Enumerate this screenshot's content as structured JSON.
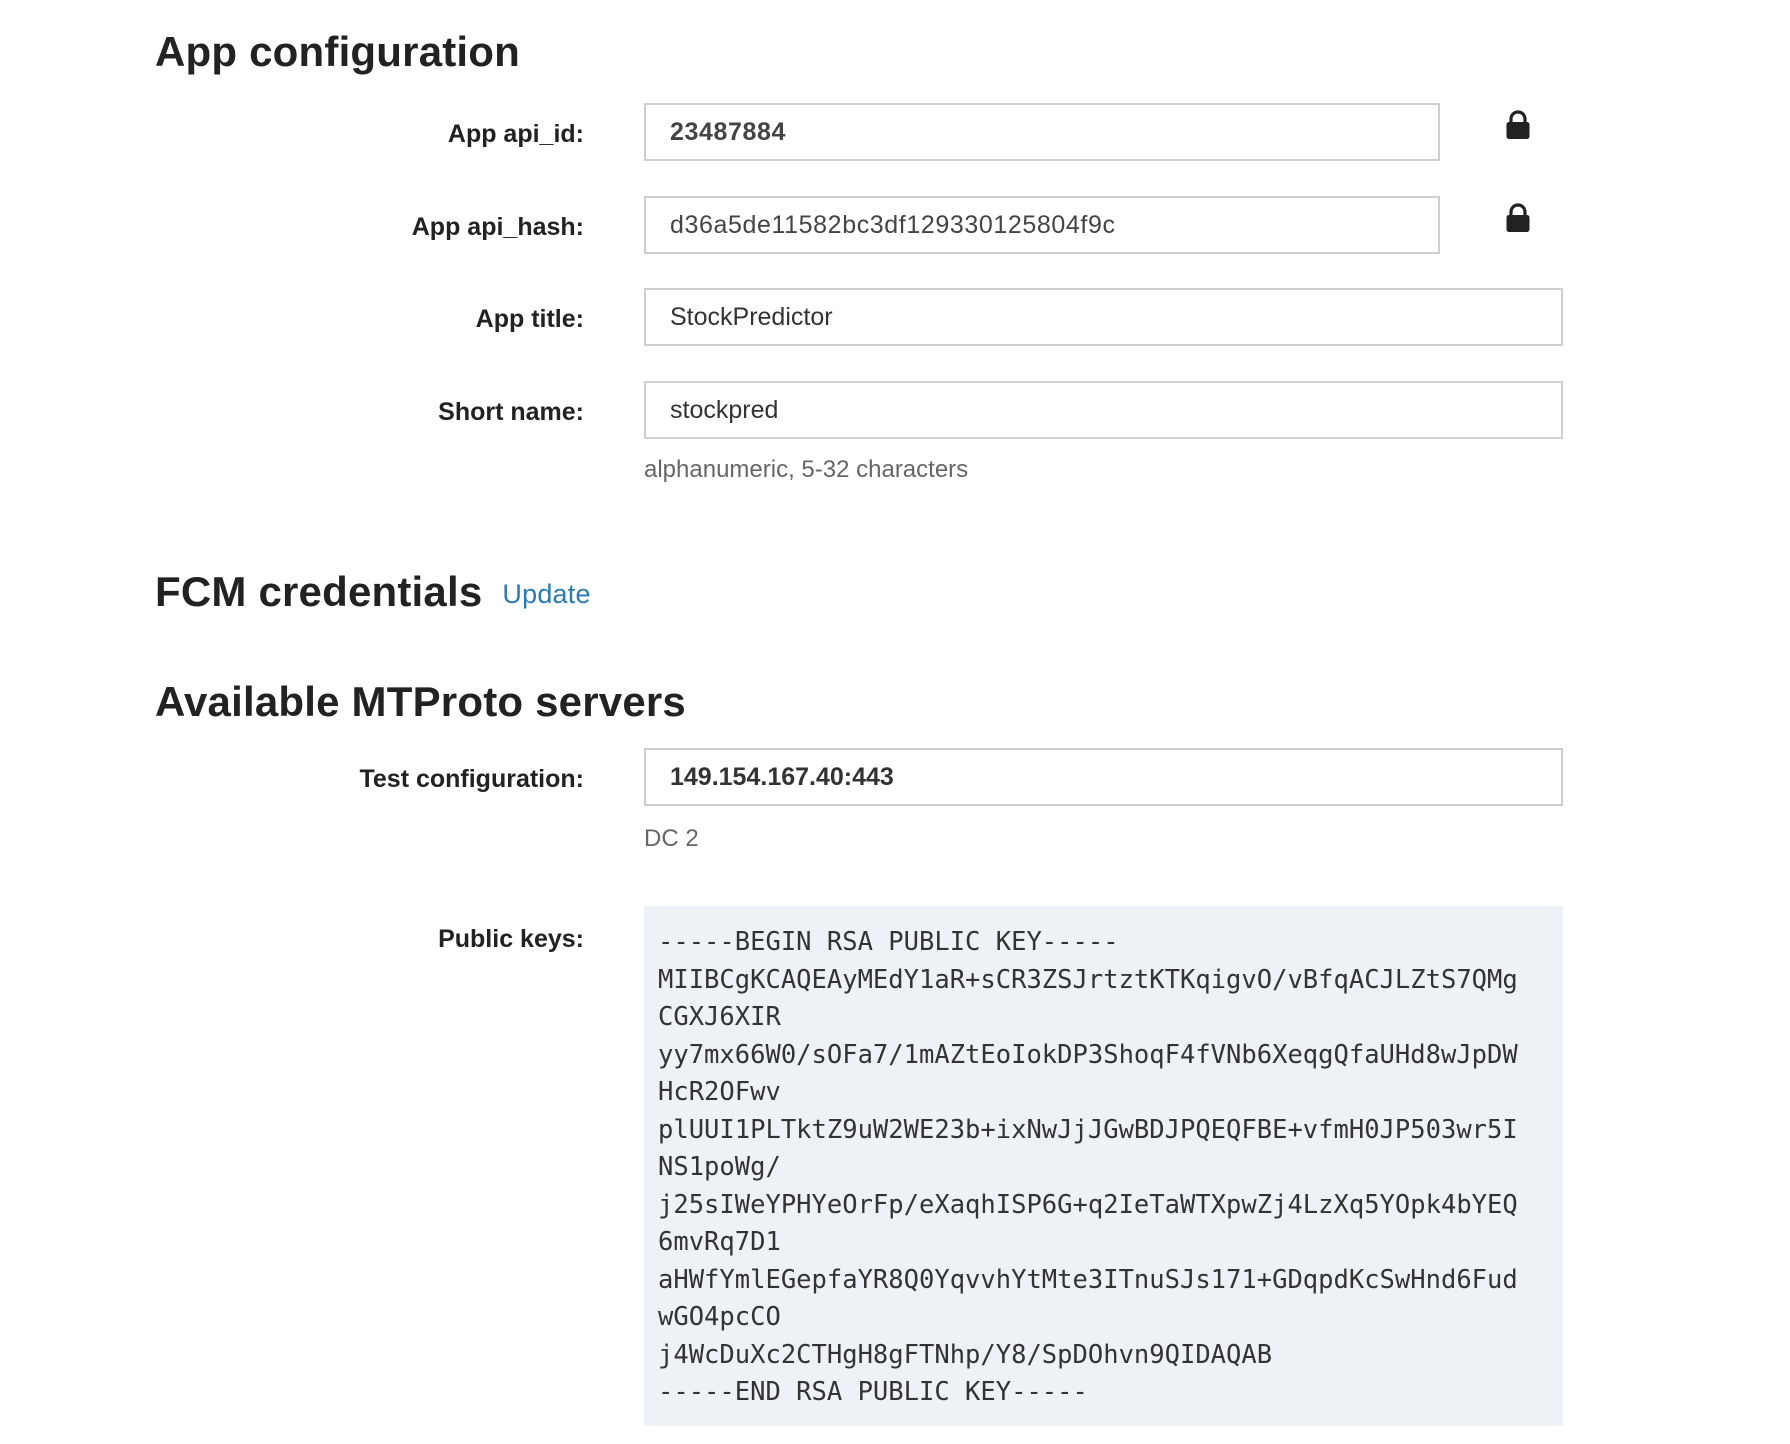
{
  "app_configuration": {
    "title": "App configuration",
    "api_id": {
      "label": "App api_id:",
      "value": "23487884"
    },
    "api_hash": {
      "label": "App api_hash:",
      "value": "d36a5de11582bc3df129330125804f9c"
    },
    "app_title": {
      "label": "App title:",
      "value": "StockPredictor"
    },
    "short_name": {
      "label": "Short name:",
      "value": "stockpred",
      "hint": "alphanumeric, 5-32 characters"
    }
  },
  "fcm": {
    "title": "FCM credentials",
    "update_label": "Update"
  },
  "servers": {
    "title": "Available MTProto servers",
    "test_config": {
      "label": "Test configuration:",
      "value": "149.154.167.40:443",
      "hint": "DC 2"
    },
    "public_keys": {
      "label": "Public keys:",
      "value": "-----BEGIN RSA PUBLIC KEY-----\nMIIBCgKCAQEAyMEdY1aR+sCR3ZSJrtztKTKqigvO/vBfqACJLZtS7QMg\nCGXJ6XIR\nyy7mx66W0/sOFa7/1mAZtEoIokDP3ShoqF4fVNb6XeqgQfaUHd8wJpDW\nHcR2OFwv\nplUUI1PLTktZ9uW2WE23b+ixNwJjJGwBDJPQEQFBE+vfmH0JP503wr5I\nNS1poWg/\nj25sIWeYPHYeOrFp/eXaqhISP6G+q2IeTaWTXpwZj4LzXq5YOpk4bYEQ\n6mvRq7D1\naHWfYmlEGepfaYR8Q0YqvvhYtMte3ITnuSJs171+GDqpdKcSwHnd6Fud\nwGO4pcCO\nj4WcDuXc2CTHgH8gFTNhp/Y8/SpDOhvn9QIDAQAB\n-----END RSA PUBLIC KEY-----"
    }
  },
  "icons": {
    "lock": "lock-icon"
  },
  "colors": {
    "link": "#2a7ab8",
    "key_background": "#eef2f6",
    "border": "#cfcfcf"
  }
}
